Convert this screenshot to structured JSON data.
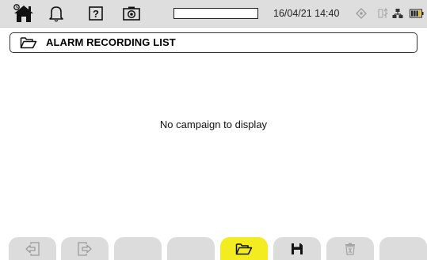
{
  "status_bar": {
    "home_icon": "home-icon",
    "alarm_icon": "bell-icon",
    "help_icon": "help-icon",
    "camera_icon": "camera-icon",
    "datetime": "16/04/21 14:40",
    "indicator_icons": [
      "gps-icon",
      "usb-icon",
      "network-icon",
      "battery-icon"
    ]
  },
  "title": {
    "icon": "folder-open-icon",
    "text": "ALARM RECORDING LIST"
  },
  "main": {
    "empty_message": "No campaign to display"
  },
  "softkeys": [
    {
      "icon": "exit-left-icon",
      "state": "disabled"
    },
    {
      "icon": "exit-right-icon",
      "state": "disabled"
    },
    {
      "icon": "",
      "state": "empty"
    },
    {
      "icon": "",
      "state": "empty"
    },
    {
      "icon": "folder-open-icon",
      "state": "active"
    },
    {
      "icon": "save-icon",
      "state": "enabled"
    },
    {
      "icon": "trash-icon",
      "state": "disabled"
    },
    {
      "icon": "",
      "state": "empty"
    }
  ],
  "colors": {
    "bar_grey": "#dedede",
    "softkey_grey": "#dcdcdc",
    "active_yellow": "#f3ec20",
    "battery_yellow": "#e6b800"
  }
}
